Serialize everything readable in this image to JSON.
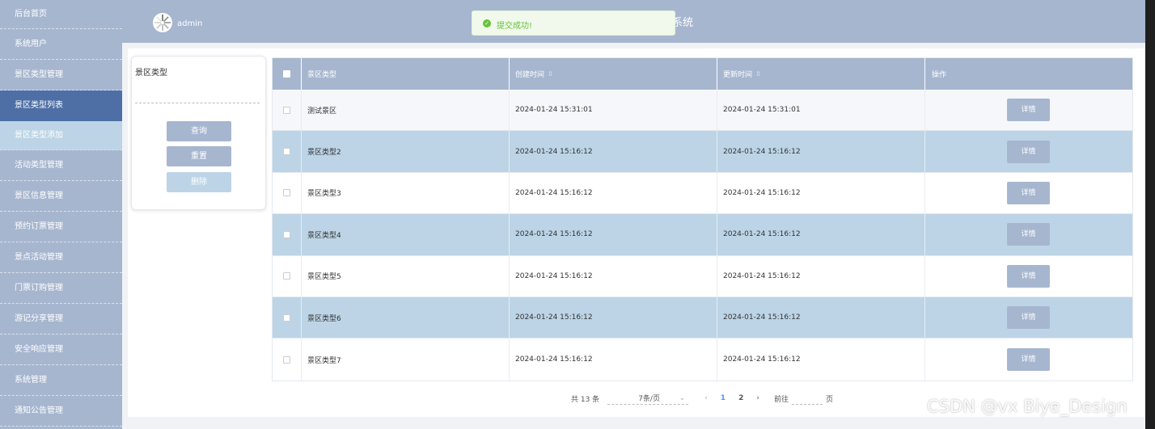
{
  "sidebar": {
    "items": [
      {
        "label": "后台首页",
        "kind": "head"
      },
      {
        "label": "系统用户",
        "kind": "normal"
      },
      {
        "label": "景区类型管理",
        "kind": "normal"
      },
      {
        "label": "景区类型列表",
        "kind": "active"
      },
      {
        "label": "景区类型添加",
        "kind": "sub"
      },
      {
        "label": "活动类型管理",
        "kind": "normal"
      },
      {
        "label": "景区信息管理",
        "kind": "normal"
      },
      {
        "label": "预约订票管理",
        "kind": "normal"
      },
      {
        "label": "景点活动管理",
        "kind": "normal"
      },
      {
        "label": "门票订购管理",
        "kind": "normal"
      },
      {
        "label": "游记分享管理",
        "kind": "normal"
      },
      {
        "label": "安全响应管理",
        "kind": "normal"
      },
      {
        "label": "系统管理",
        "kind": "normal"
      },
      {
        "label": "通知公告管理",
        "kind": "normal"
      }
    ]
  },
  "header": {
    "username": "admin",
    "title_fragment": "系统"
  },
  "toast": {
    "message": "提交成功!",
    "color": "#67c23a"
  },
  "search": {
    "label": "景区类型",
    "input_value": "",
    "query_label": "查询",
    "reset_label": "重置",
    "delete_label": "删除"
  },
  "table": {
    "columns": [
      "景区类型",
      "创建时间",
      "更新时间",
      "操作"
    ],
    "sort_indicator": "⇳",
    "detail_label": "详情",
    "rows": [
      {
        "type": "测试景区",
        "created": "2024-01-24 15:31:01",
        "updated": "2024-01-24 15:31:01"
      },
      {
        "type": "景区类型2",
        "created": "2024-01-24 15:16:12",
        "updated": "2024-01-24 15:16:12"
      },
      {
        "type": "景区类型3",
        "created": "2024-01-24 15:16:12",
        "updated": "2024-01-24 15:16:12"
      },
      {
        "type": "景区类型4",
        "created": "2024-01-24 15:16:12",
        "updated": "2024-01-24 15:16:12"
      },
      {
        "type": "景区类型5",
        "created": "2024-01-24 15:16:12",
        "updated": "2024-01-24 15:16:12"
      },
      {
        "type": "景区类型6",
        "created": "2024-01-24 15:16:12",
        "updated": "2024-01-24 15:16:12"
      },
      {
        "type": "景区类型7",
        "created": "2024-01-24 15:16:12",
        "updated": "2024-01-24 15:16:12"
      }
    ]
  },
  "pagination": {
    "total": "共 13 条",
    "page_size": "7条/页",
    "pages": [
      "1",
      "2"
    ],
    "current_page": "1",
    "goto_prefix": "前往",
    "goto_suffix": "页"
  },
  "watermark": "CSDN @vx Biye_Design",
  "colors": {
    "theme": "#a7b6cf",
    "active": "#4d6fa5",
    "light": "#bcd4e6",
    "success": "#67c23a"
  }
}
